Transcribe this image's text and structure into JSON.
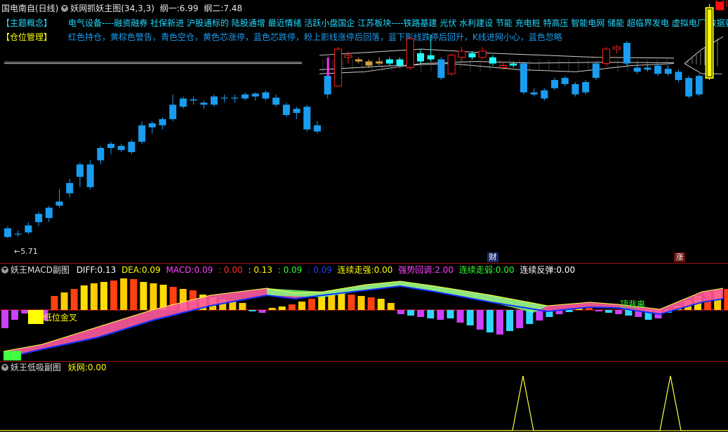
{
  "header": {
    "stock": "国电南自(日线)",
    "indicator": "妖网抓妖主图(34,3,3)",
    "line1_label": "纲一:",
    "line1_value": "6.99",
    "line2_label": "纲二:",
    "line2_value": "7.48"
  },
  "info": {
    "concept_tag": "【主题概念】",
    "concept_text": "电气设备----融资融券 社保新进 沪股通标的 陆股通增 最近情绪 活跃小盘国企 江苏板块----铁路基建 光伏 水利建设 节能 充电桩 特高压 智能电网 储能 超临界发电 虚拟电厂 数据要素",
    "position_tag": "【仓位管理】",
    "position_text": "红色持仓，黄棕色警告，青色空仓，黄色芯涨停，蓝色芯跌停，粉上影线涨停后回落，蓝下影线跌停后回升，K线进网小心，蓝色忽略"
  },
  "main_chart": {
    "low_label": "←5.71",
    "marker_cai": "财",
    "marker_zhang": "涨",
    "price_range": [
      5.5,
      10.3
    ],
    "colors": {
      "red": "#ff2020",
      "cyan": "#20ffff",
      "blue": "#1a9cf0",
      "yellow": "#ffff00",
      "tan": "#d4a040",
      "magenta": "#ff30ff",
      "net": "#d0d0d0"
    }
  },
  "macd_panel": {
    "title": "妖王MACD副图",
    "diff_label": "DIFF:",
    "diff_value": "0.13",
    "dea_label": "DEA:",
    "dea_value": "0.09",
    "macd_label": "MACD:",
    "macd_value": "0.09",
    "v1": "0.00",
    "v2": "0.13",
    "v3": "0.09",
    "v4": "0.09",
    "strong_label": "连续走强:",
    "strong_value": "0.00",
    "pullback_label": "强势回调:",
    "pullback_value": "2.00",
    "weak_label": "连续走弱:",
    "weak_value": "0.00",
    "rebound_label": "连续反弹:",
    "rebound_value": "0.00",
    "gold_cross_label": "低位金叉",
    "top_div_label": "顶背离"
  },
  "low_panel": {
    "title": "妖王低吸副图",
    "yw_label": "妖网:",
    "yw_value": "0.00"
  }
}
